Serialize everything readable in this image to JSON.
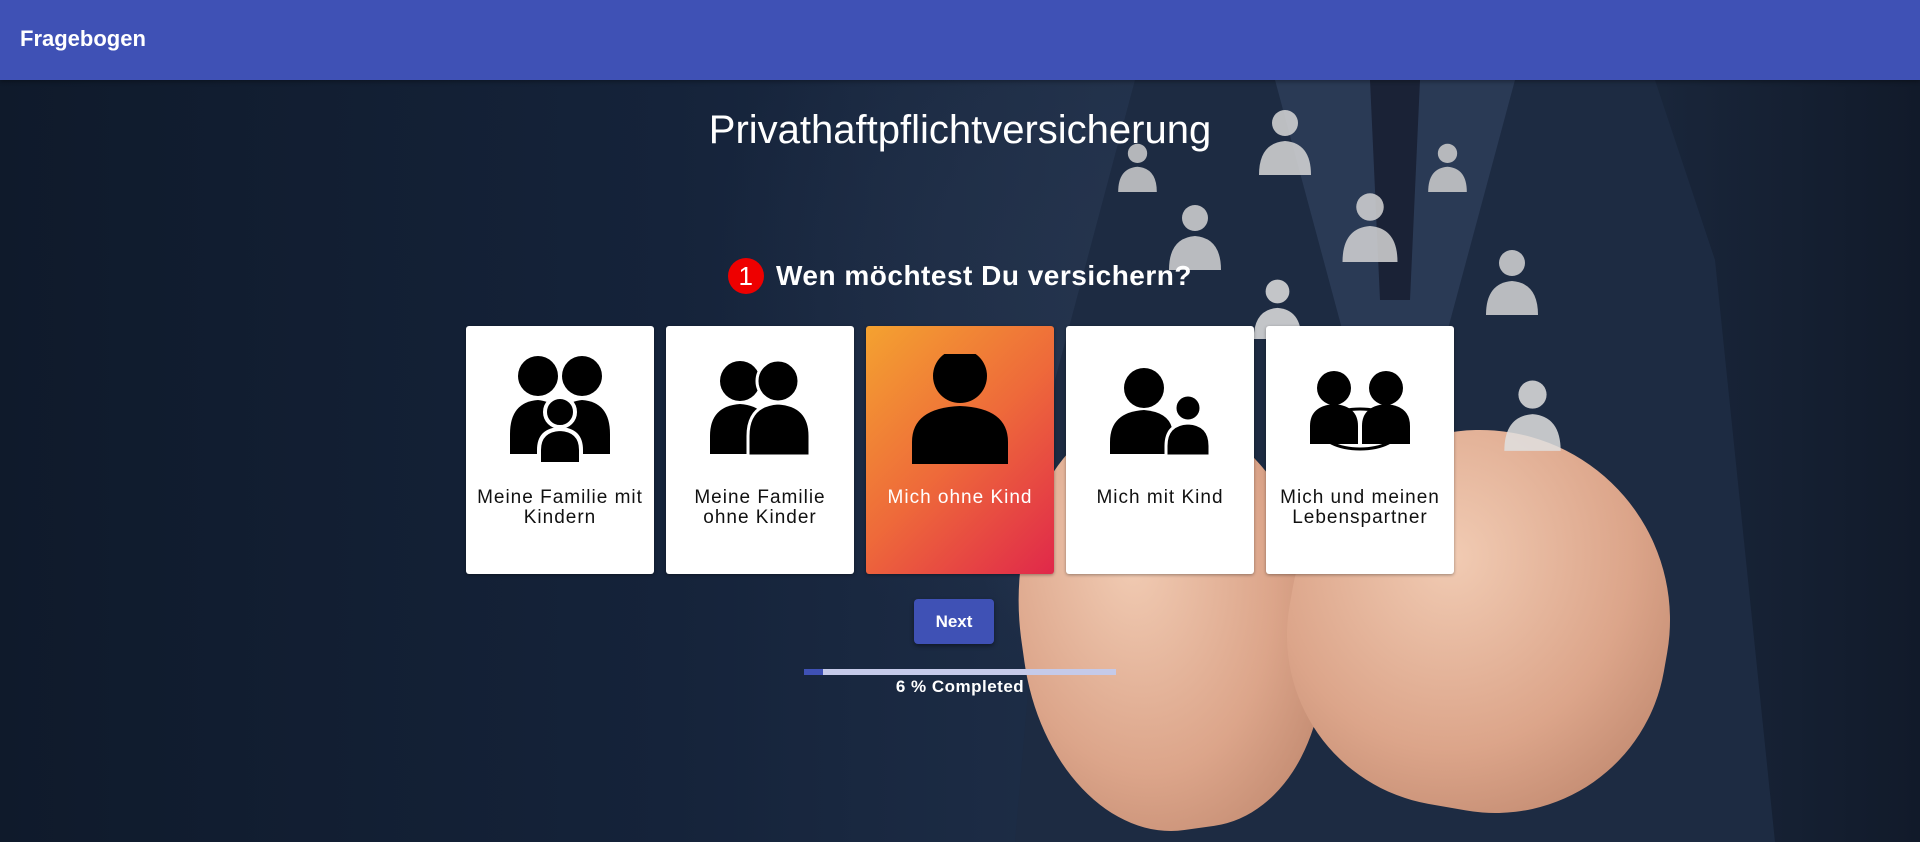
{
  "appbar": {
    "title": "Fragebogen"
  },
  "page": {
    "title": "Privathaftpflichtversicherung"
  },
  "question": {
    "number": "1",
    "text": "Wen möchtest Du versichern?"
  },
  "options": [
    {
      "label": "Meine Familie mit Kindern",
      "icon": "family-with-child-icon",
      "selected": false
    },
    {
      "label": "Meine Familie ohne Kinder",
      "icon": "couple-icon",
      "selected": false
    },
    {
      "label": "Mich ohne Kind",
      "icon": "single-person-icon",
      "selected": true
    },
    {
      "label": "Mich mit Kind",
      "icon": "parent-with-child-icon",
      "selected": false
    },
    {
      "label": "Mich und meinen Lebenspartner",
      "icon": "partners-icon",
      "selected": false
    }
  ],
  "next_button": {
    "label": "Next"
  },
  "progress": {
    "percent": 6,
    "text": "6 % Completed"
  },
  "colors": {
    "primary": "#3f51b5",
    "selected_gradient_start": "#f4a230",
    "selected_gradient_end": "#e0284a",
    "step_badge": "#ee0000"
  }
}
